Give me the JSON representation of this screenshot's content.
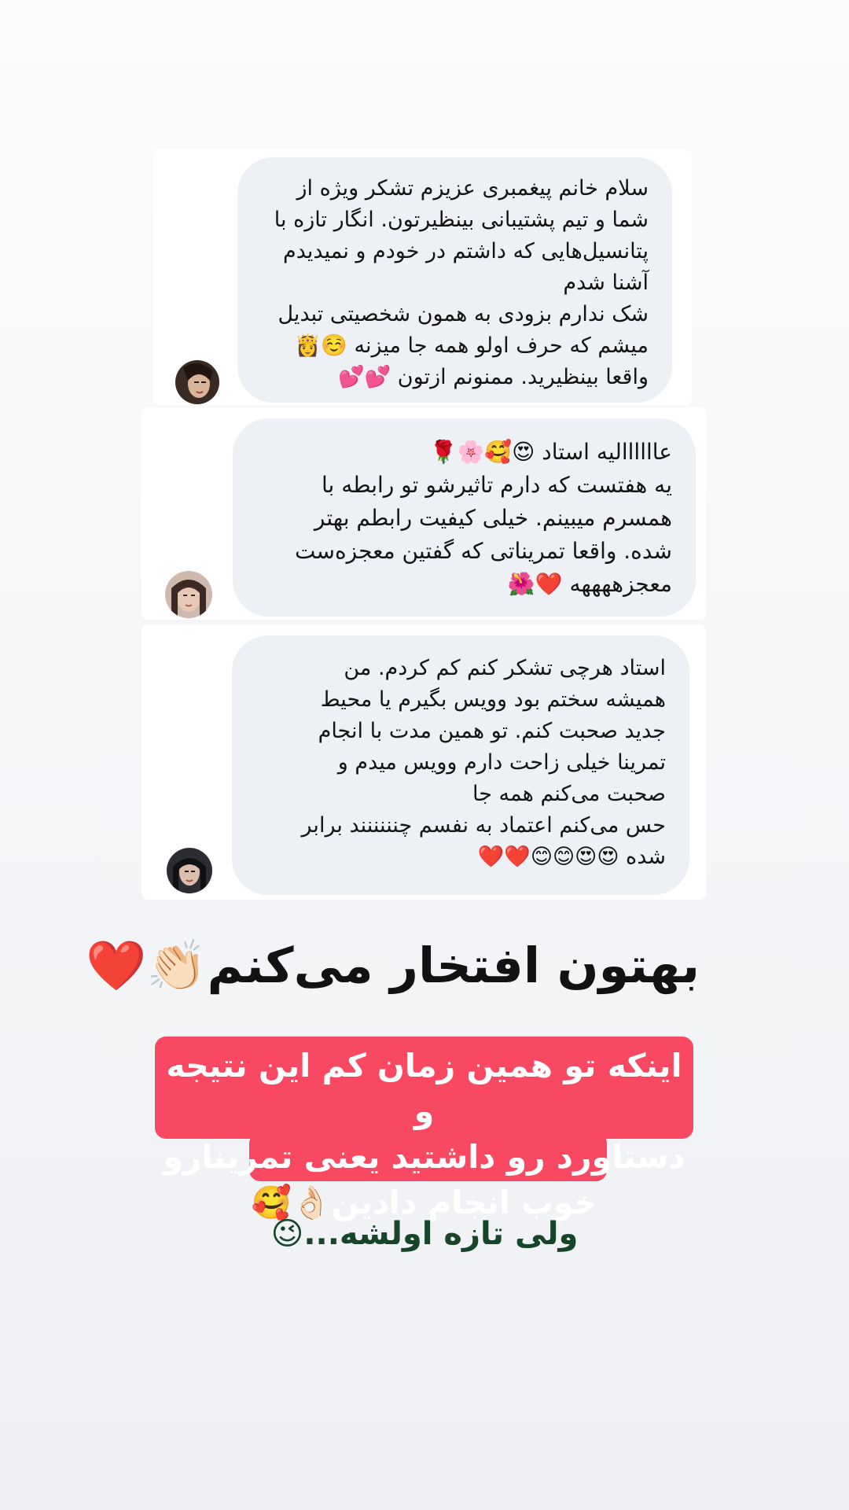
{
  "messages": [
    {
      "text": "سلام خانم پیغمبری عزیزم تشکر ویژه از\nشما و تیم پشتیبانی بینظیرتون. انگار تازه با\nپتانسیل‌هایی که داشتم در خودم و نمیدیدم\nآشنا شدم\nشک ندارم بزودی به همون شخصیتی تبدیل\nمیشم که حرف اولو همه جا میزنه ☺️👸\nواقعا بینظیرید. ممنونم ازتون 💕💕",
      "avatar_icon": "avatar-woman-1"
    },
    {
      "text": "عاااااالیه استاد 😍🥰🌸🌹\nیه هفتست که دارم تاثیرشو تو رابطه با\nهمسرم میبینم. خیلی کیفیت رابطم بهتر\nشده. واقعا تمریناتی که گفتین معجزه‌ست\nمعجزههههه ❤️🌺",
      "avatar_icon": "avatar-woman-2"
    },
    {
      "text": "استاد هرچی تشکر کنم کم کردم. من\nهمیشه سختم بود وویس بگیرم یا محیط\nجدید صحبت کنم. تو همین مدت با انجام\nتمرینا خیلی زاحت دارم وویس میدم و\nصحبت می‌کنم همه جا\nحس می‌کنم اعتماد به نفسم چنننننند برابر\nشده 😍😍😊😊❤️❤️",
      "avatar_icon": "avatar-woman-3"
    }
  ],
  "headline": "بهتون افتخار می‌کنم👏🏻❤️",
  "promo": "اینکه تو همین زمان کم این نتیجه و\nدستاورد رو داشتید یعنی تمرینارو\nخوب انجام دادین👌🏻🥰",
  "footer_note": "ولی تازه اولشه...😉",
  "colors": {
    "bubble": "#edf0f4",
    "promo_bg": "#f94861",
    "footer_text": "#17452a"
  }
}
